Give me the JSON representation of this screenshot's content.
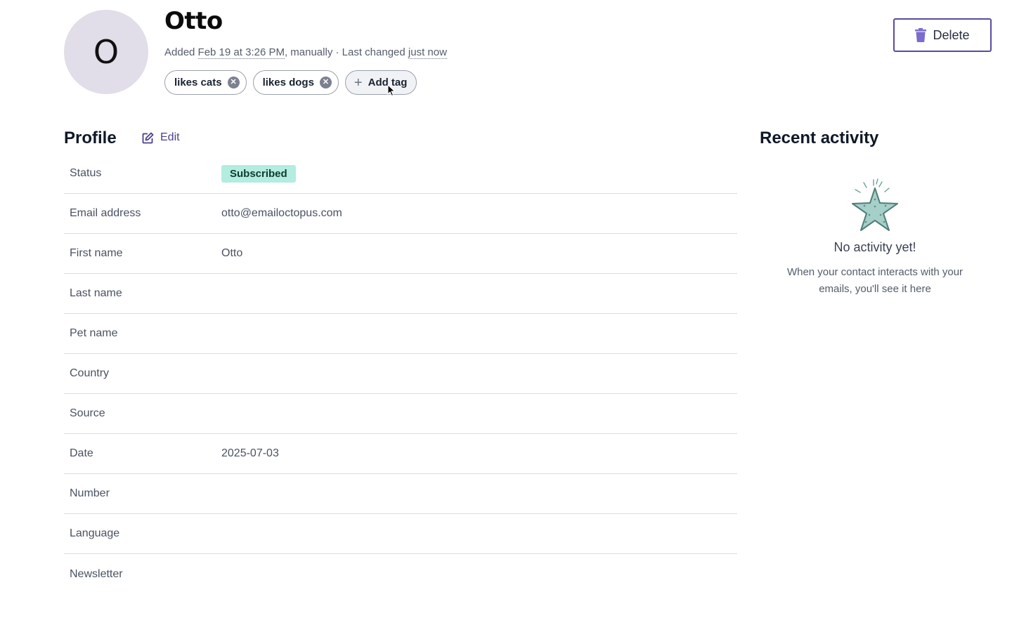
{
  "contact": {
    "avatar_initial": "O",
    "name": "Otto",
    "meta": {
      "added_prefix": "Added",
      "added_date": "Feb 19 at 3:26 PM",
      "added_suffix": ", manually · Last changed",
      "changed": "just now"
    }
  },
  "tags": [
    "likes cats",
    "likes dogs"
  ],
  "add_tag_label": "Add tag",
  "delete_label": "Delete",
  "profile": {
    "title": "Profile",
    "edit_label": "Edit",
    "status_label": "Status",
    "status_value": "Subscribed",
    "fields": [
      {
        "label": "Email address",
        "value": "otto@emailoctopus.com"
      },
      {
        "label": "First name",
        "value": "Otto"
      },
      {
        "label": "Last name",
        "value": ""
      },
      {
        "label": "Pet name",
        "value": ""
      },
      {
        "label": "Country",
        "value": ""
      },
      {
        "label": "Source",
        "value": ""
      },
      {
        "label": "Date",
        "value": "2025-07-03"
      },
      {
        "label": "Number",
        "value": ""
      },
      {
        "label": "Language",
        "value": ""
      },
      {
        "label": "Newsletter",
        "value": ""
      }
    ]
  },
  "activity": {
    "title": "Recent activity",
    "empty_title": "No activity yet!",
    "empty_desc": "When your contact interacts with your emails, you'll see it here"
  },
  "colors": {
    "accent": "#5b4a9e",
    "badge_bg": "#b3ece0",
    "avatar_bg": "#e1dde9",
    "row_border": "#cfe3e0"
  }
}
